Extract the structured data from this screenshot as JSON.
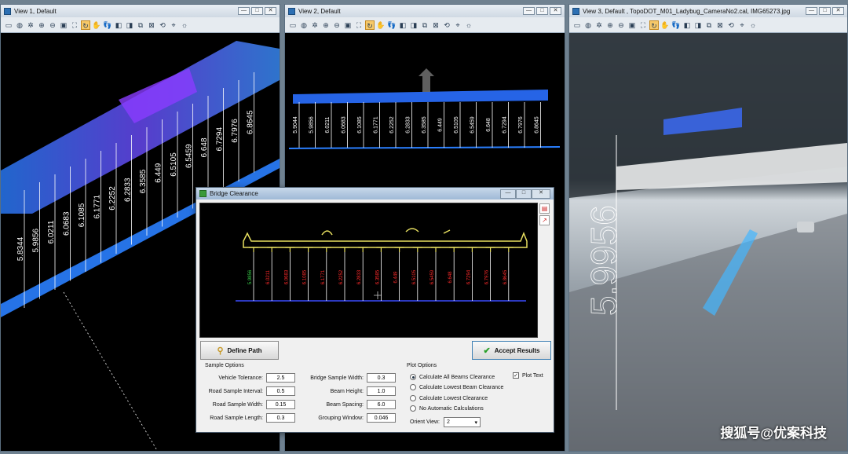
{
  "views": [
    {
      "title": "View 1, Default"
    },
    {
      "title": "View 2, Default"
    },
    {
      "title": "View 3, Default , TopoDOT_M01_Ladybug_CameraNo2.cal, IMG65273.jpg"
    }
  ],
  "window_buttons": {
    "min": "—",
    "max": "□",
    "close": "✕"
  },
  "view1_labels": [
    "5.8344",
    "5.9856",
    "6.0211",
    "6.0683",
    "6.1085",
    "6.1771",
    "6.2252",
    "6.2833",
    "6.3585",
    "6.449",
    "6.5105",
    "6.5459",
    "6.648",
    "6.7294",
    "6.7976",
    "6.8645"
  ],
  "view2_labels": [
    "5.9044",
    "5.9856",
    "6.0211",
    "6.0683",
    "6.1085",
    "6.1771",
    "6.2252",
    "6.2833",
    "6.3585",
    "6.449",
    "6.5105",
    "6.5459",
    "6.648",
    "6.7294",
    "6.7976",
    "6.8645"
  ],
  "view3_label": "5.9956",
  "dialog": {
    "title": "Bridge Clearance",
    "clearance_labels": [
      "5.9856",
      "6.0211",
      "6.0683",
      "6.1085",
      "6.1771",
      "6.2252",
      "6.2833",
      "6.3585",
      "6.449",
      "6.5105",
      "6.5459",
      "6.648",
      "6.7294",
      "6.7976",
      "6.8645"
    ],
    "define_path": "Define Path",
    "accept": "Accept Results",
    "sample_options": "Sample Options",
    "plot_options": "Plot Options",
    "fields_left": [
      {
        "label": "Vehicle Tolerance:",
        "value": "2.5"
      },
      {
        "label": "Road Sample Interval:",
        "value": "0.5"
      },
      {
        "label": "Road Sample Width:",
        "value": "0.15"
      },
      {
        "label": "Road Sample Length:",
        "value": "0.3"
      }
    ],
    "fields_mid": [
      {
        "label": "Bridge Sample Width:",
        "value": "0.3"
      },
      {
        "label": "Beam Height:",
        "value": "1.0"
      },
      {
        "label": "Beam Spacing:",
        "value": "6.0"
      },
      {
        "label": "Grouping Window:",
        "value": "0.046"
      }
    ],
    "radios": [
      {
        "label": "Calculate All Beams Clearance",
        "selected": true
      },
      {
        "label": "Calculate Lowest Beam Clearance",
        "selected": false
      },
      {
        "label": "Calculate Lowest Clearance",
        "selected": false
      },
      {
        "label": "No Automatic Calculations",
        "selected": false
      }
    ],
    "plot_text": "Plot Text",
    "orient_label": "Orient View:",
    "orient_value": "2"
  },
  "watermark": "搜狐号@优案科技",
  "colors": {
    "point_blue": "#2a7fff",
    "point_purple": "#8a3cff",
    "line_white": "#ffffff",
    "dialog_yellow": "#e8e060",
    "label_red": "#ff2a2a",
    "label_green": "#39d24a"
  }
}
